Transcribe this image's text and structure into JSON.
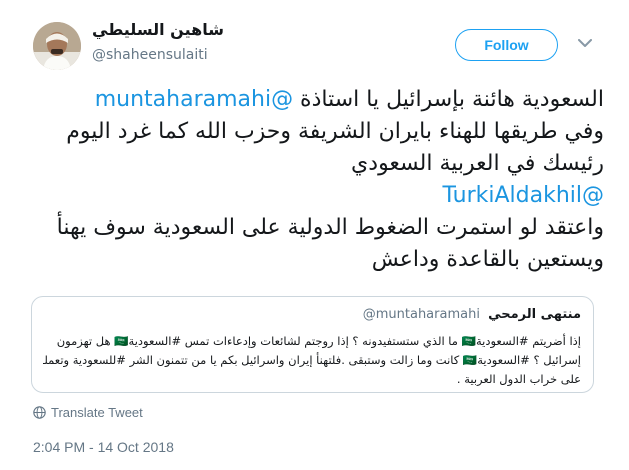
{
  "author": {
    "display_name": "شاهين السليطي",
    "handle": "@shaheensulaiti",
    "avatar_icon": "user-avatar-photo"
  },
  "actions": {
    "follow_label": "Follow",
    "menu_icon": "chevron-down-icon"
  },
  "tweet": {
    "lines": [
      {
        "mention": "@muntaharamahi",
        "text": "السعودية هائنة بإسرائيل يا استاذة "
      },
      {
        "mention": "",
        "text": "وفي طريقها للهناء بايران الشريفة وحزب الله كما غرد اليوم"
      },
      {
        "mention": "",
        "text": "رئيسك في العربية  السعودي"
      },
      {
        "mention": "@TurkiAldakhil",
        "text": ""
      },
      {
        "mention": "",
        "text": "واعتقد لو استمرت الضغوط الدولية على السعودية سوف يهنأ"
      },
      {
        "mention": "",
        "text": "ويستعين بالقاعدة وداعش"
      }
    ]
  },
  "quoted_tweet": {
    "display_name": "منتهى الرمحي",
    "handle": "@muntaharamahi",
    "lines": [
      "إذا أضريتم #السعودية🇸🇦 ما الذي ستستفيدونه ؟ إذا روجتم لشائعات وإدعاءات تمس #السعودية🇸🇦 هل تهزمون",
      "إسرائيل ؟ #السعودية🇸🇦 كانت وما زالت وستبقى .فلتهنأ إيران واسرائيل بكم يا من تتمنون الشر #للسعودية وتعملون",
      "على خراب الدول العربية ."
    ]
  },
  "translate": {
    "label": "Translate Tweet",
    "icon": "globe-icon"
  },
  "timestamp": "2:04 PM - 14 Oct 2018",
  "colors": {
    "accent": "#1da1f2",
    "link": "#1b95e0",
    "secondary_text": "#657786",
    "border": "#ccd6dd"
  }
}
